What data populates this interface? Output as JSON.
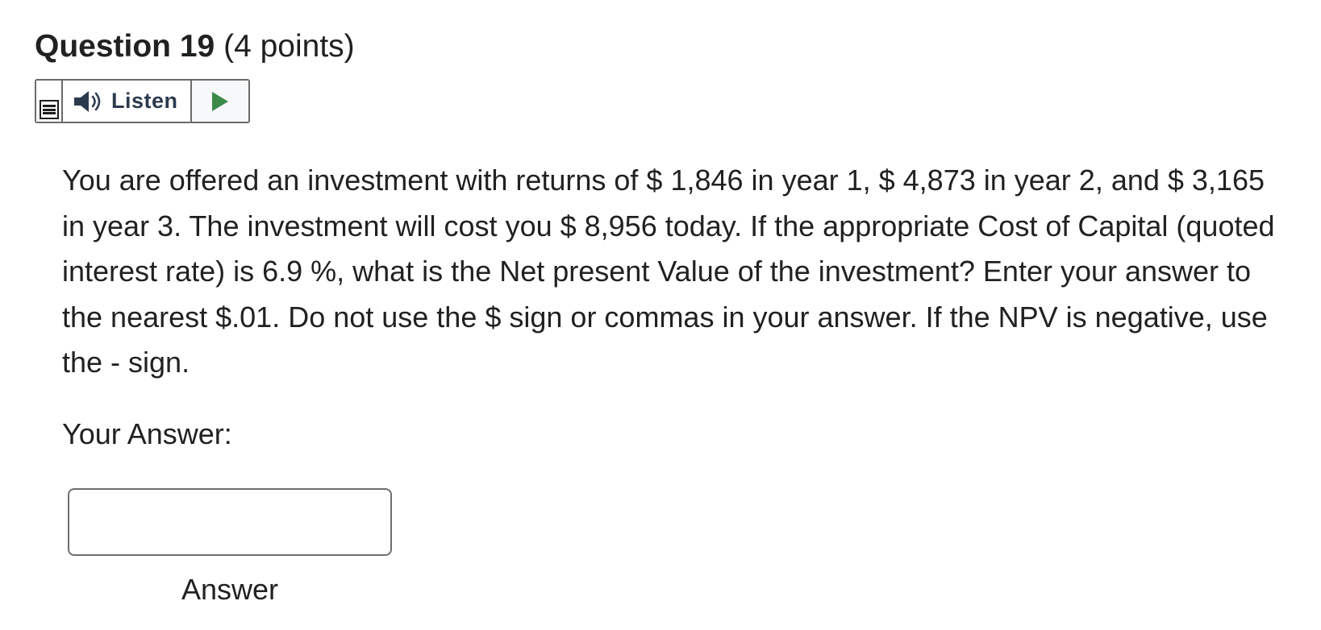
{
  "question": {
    "title": "Question 19",
    "points": "(4 points)"
  },
  "listen_toolbar": {
    "menu_icon": "menu-icon",
    "speaker_icon": "speaker-icon",
    "listen_label": "Listen",
    "play_icon": "play-icon",
    "play_color": "#3c8a4a"
  },
  "body": {
    "text": "You are offered an investment with returns of $ 1,846 in year 1, $ 4,873 in year 2, and $ 3,165 in year 3. The investment will cost you $ 8,956 today. If the appropriate Cost of Capital (quoted interest rate) is 6.9 %, what is the Net present Value of the investment? Enter your answer to the nearest $.01. Do not use the $ sign or commas in your answer. If the NPV is negative, use the - sign."
  },
  "answer": {
    "prompt": "Your Answer:",
    "value": "",
    "caption": "Answer"
  }
}
